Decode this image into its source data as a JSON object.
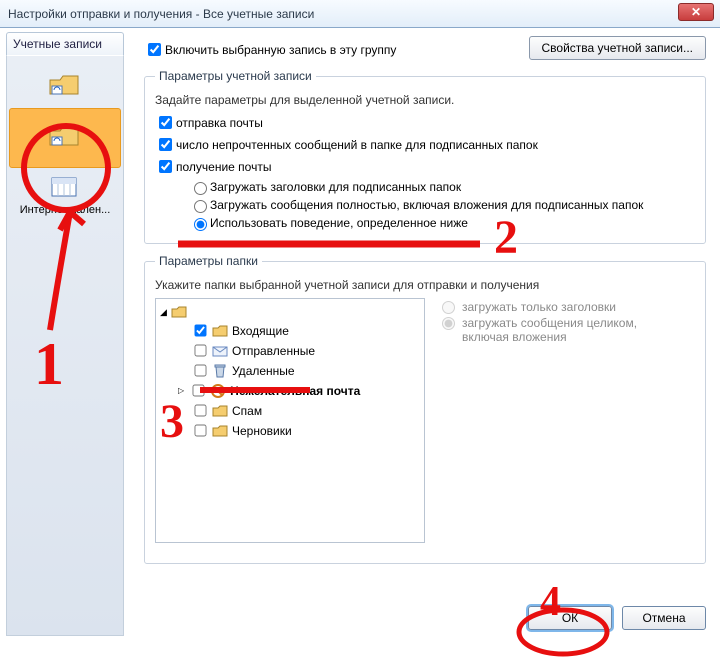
{
  "window": {
    "title": "Настройки отправки и получения - Все учетные записи",
    "close": "✕"
  },
  "side": {
    "tab": "Учетные записи",
    "item3": "Интернет-кален..."
  },
  "main": {
    "include_label": "Включить выбранную запись в эту группу",
    "props_btn": "Свойства учетной записи..."
  },
  "account": {
    "legend": "Параметры учетной записи",
    "hint": "Задайте параметры для выделенной учетной записи.",
    "send": "отправка почты",
    "unread": "число непрочтенных сообщений в папке для подписанных папок",
    "receive": "получение почты",
    "r1": "Загружать заголовки для подписанных папок",
    "r2": "Загружать сообщения полностью, включая вложения для подписанных папок",
    "r3": "Использовать поведение, определенное ниже"
  },
  "folder": {
    "legend": "Параметры папки",
    "hint": "Укажите папки выбранной учетной записи для отправки и получения",
    "items": {
      "inbox": "Входящие",
      "sent": "Отправленные",
      "deleted": "Удаленные",
      "junk": "Нежелательная почта",
      "spam": "Спам",
      "drafts": "Черновики"
    },
    "side_r1": "загружать только заголовки",
    "side_r2": "загружать сообщения целиком, включая вложения"
  },
  "buttons": {
    "ok": "ОК",
    "cancel": "Отмена"
  },
  "anno": {
    "a1": "1",
    "a2": "2",
    "a3": "3",
    "a4": "4"
  }
}
